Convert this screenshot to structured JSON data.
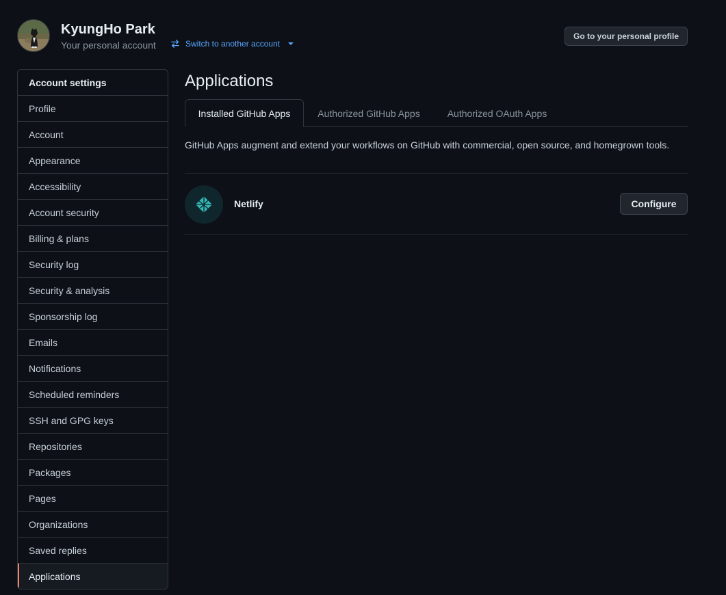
{
  "header": {
    "user_name": "KyungHo Park",
    "user_subtitle": "Your personal account",
    "switch_account_label": "Switch to another account",
    "profile_button_label": "Go to your personal profile"
  },
  "sidebar": {
    "heading": "Account settings",
    "items": [
      {
        "label": "Profile"
      },
      {
        "label": "Account"
      },
      {
        "label": "Appearance"
      },
      {
        "label": "Accessibility"
      },
      {
        "label": "Account security"
      },
      {
        "label": "Billing & plans"
      },
      {
        "label": "Security log"
      },
      {
        "label": "Security & analysis"
      },
      {
        "label": "Sponsorship log"
      },
      {
        "label": "Emails"
      },
      {
        "label": "Notifications"
      },
      {
        "label": "Scheduled reminders"
      },
      {
        "label": "SSH and GPG keys"
      },
      {
        "label": "Repositories"
      },
      {
        "label": "Packages"
      },
      {
        "label": "Pages"
      },
      {
        "label": "Organizations"
      },
      {
        "label": "Saved replies"
      },
      {
        "label": "Applications",
        "active": true
      }
    ]
  },
  "main": {
    "title": "Applications",
    "tabs": [
      {
        "label": "Installed GitHub Apps",
        "active": true
      },
      {
        "label": "Authorized GitHub Apps"
      },
      {
        "label": "Authorized OAuth Apps"
      }
    ],
    "description": "GitHub Apps augment and extend your workflows on GitHub with commercial, open source, and homegrown tools.",
    "apps": [
      {
        "name": "Netlify",
        "button_label": "Configure",
        "icon": "netlify-icon"
      }
    ]
  },
  "colors": {
    "background": "#0d1117",
    "border": "#30363d",
    "link": "#58a6ff",
    "active_indicator": "#f78166",
    "netlify_teal": "#32b7b4"
  }
}
